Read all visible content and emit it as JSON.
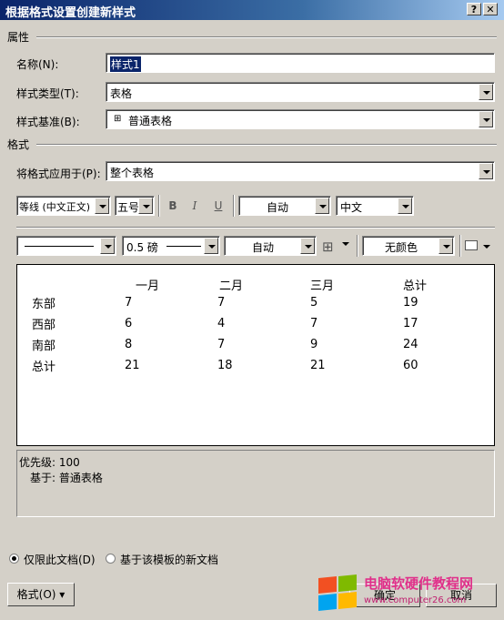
{
  "window": {
    "title": "根据格式设置创建新样式",
    "help_glyph": "?",
    "close_glyph": "✕"
  },
  "properties": {
    "section": "属性",
    "name_label": "名称(N):",
    "name_value": "样式1",
    "type_label": "样式类型(T):",
    "type_value": "表格",
    "based_label": "样式基准(B):",
    "based_value": "普通表格"
  },
  "format": {
    "section": "格式",
    "apply_label": "将格式应用于(P):",
    "apply_value": "整个表格",
    "font": "等线 (中文正文)",
    "size": "五号",
    "bold": "B",
    "italic": "I",
    "underline": "U",
    "color": "自动",
    "lang": "中文",
    "border_weight": "0.5 磅",
    "border_color": "自动",
    "shading": "无颜色"
  },
  "preview": {
    "headers": [
      "",
      "一月",
      "二月",
      "三月",
      "总计"
    ],
    "rows": [
      [
        "东部",
        "7",
        "7",
        "5",
        "19"
      ],
      [
        "西部",
        "6",
        "4",
        "7",
        "17"
      ],
      [
        "南部",
        "8",
        "7",
        "9",
        "24"
      ],
      [
        "总计",
        "21",
        "18",
        "21",
        "60"
      ]
    ]
  },
  "description": {
    "priority": "优先级: 100",
    "based_on": "基于: 普通表格"
  },
  "options": {
    "only_doc": "仅限此文档(D)",
    "template_doc": "基于该模板的新文档",
    "format_button": "格式(O) ▾",
    "ok": "确定",
    "cancel": "取消"
  },
  "watermark": {
    "line1": "电脑软硬件教程网",
    "line2": "www.computer26.com"
  },
  "colors": {
    "titlebar": "#0a246a",
    "dialog_bg": "#d4d0c8",
    "selection": "#0a246a"
  }
}
